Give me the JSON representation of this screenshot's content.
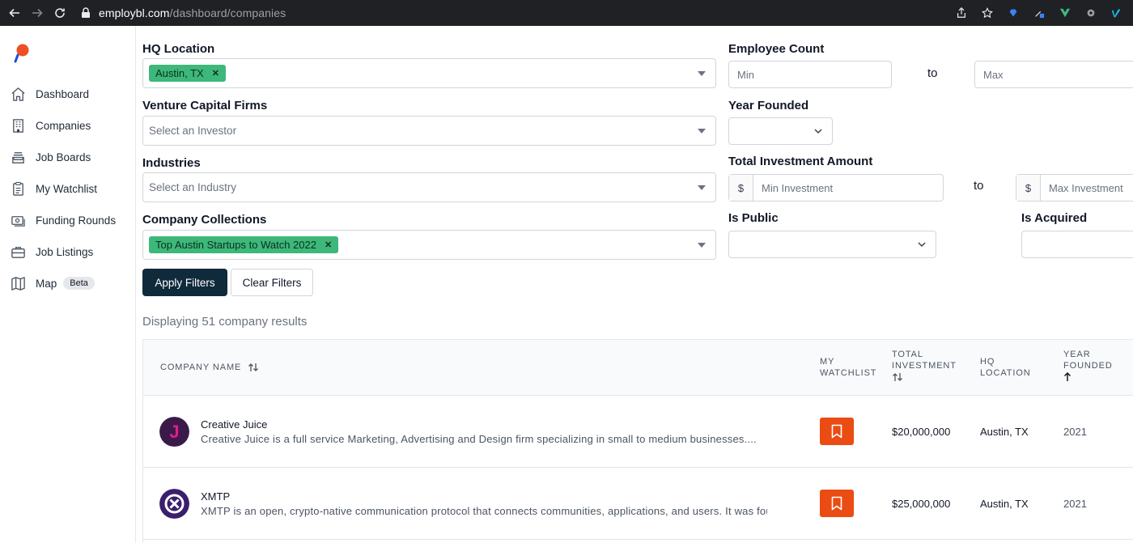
{
  "browser": {
    "url_domain": "employbl.com",
    "url_path": "/dashboard/companies"
  },
  "sidebar": {
    "items": [
      {
        "label": "Dashboard",
        "icon": "home-icon"
      },
      {
        "label": "Companies",
        "icon": "building-icon"
      },
      {
        "label": "Job Boards",
        "icon": "inbox-stack-icon"
      },
      {
        "label": "My Watchlist",
        "icon": "clipboard-icon"
      },
      {
        "label": "Funding Rounds",
        "icon": "cash-icon"
      },
      {
        "label": "Job Listings",
        "icon": "briefcase-icon"
      },
      {
        "label": "Map",
        "icon": "map-icon",
        "badge": "Beta"
      }
    ]
  },
  "filters": {
    "hq_location": {
      "label": "HQ Location",
      "tag": "Austin, TX"
    },
    "vc_firms": {
      "label": "Venture Capital Firms",
      "placeholder": "Select an Investor"
    },
    "industries": {
      "label": "Industries",
      "placeholder": "Select an Industry"
    },
    "collections": {
      "label": "Company Collections",
      "tag": "Top Austin Startups to Watch 2022"
    },
    "employee_count": {
      "label": "Employee Count",
      "min_placeholder": "Min",
      "to": "to",
      "max_placeholder": "Max"
    },
    "year_founded": {
      "label": "Year Founded"
    },
    "investment": {
      "label": "Total Investment Amount",
      "currency": "$",
      "min_placeholder": "Min Investment",
      "to": "to",
      "max_placeholder": "Max Investment"
    },
    "is_public": {
      "label": "Is Public"
    },
    "is_acquired": {
      "label": "Is Acquired"
    },
    "apply_label": "Apply Filters",
    "clear_label": "Clear Filters"
  },
  "results": {
    "count_text": "Displaying 51 company results"
  },
  "table": {
    "headers": {
      "company_name": "Company Name",
      "watchlist_1": "My",
      "watchlist_2": "Watchlist",
      "investment_1": "Total",
      "investment_2": "Investment",
      "location_1": "HQ",
      "location_2": "Location",
      "year_1": "Year",
      "year_2": "Founded"
    },
    "rows": [
      {
        "name": "Creative Juice",
        "description": "Creative Juice is a full service Marketing, Advertising and Design firm specializing in small to medium businesses....",
        "investment": "$20,000,000",
        "location": "Austin, TX",
        "year": "2021",
        "logo_color": "#3b1a4a",
        "logo_letter": "J"
      },
      {
        "name": "XMTP",
        "description": "XMTP is an open, crypto-native communication protocol that connects communities, applications, and users. It was foun...",
        "investment": "$25,000,000",
        "location": "Austin, TX",
        "year": "2021",
        "logo_color": "#3a1f6e"
      }
    ]
  },
  "colors": {
    "primary": "#0f2a3b",
    "accent": "#ea4c14",
    "tag": "#3db87a"
  }
}
